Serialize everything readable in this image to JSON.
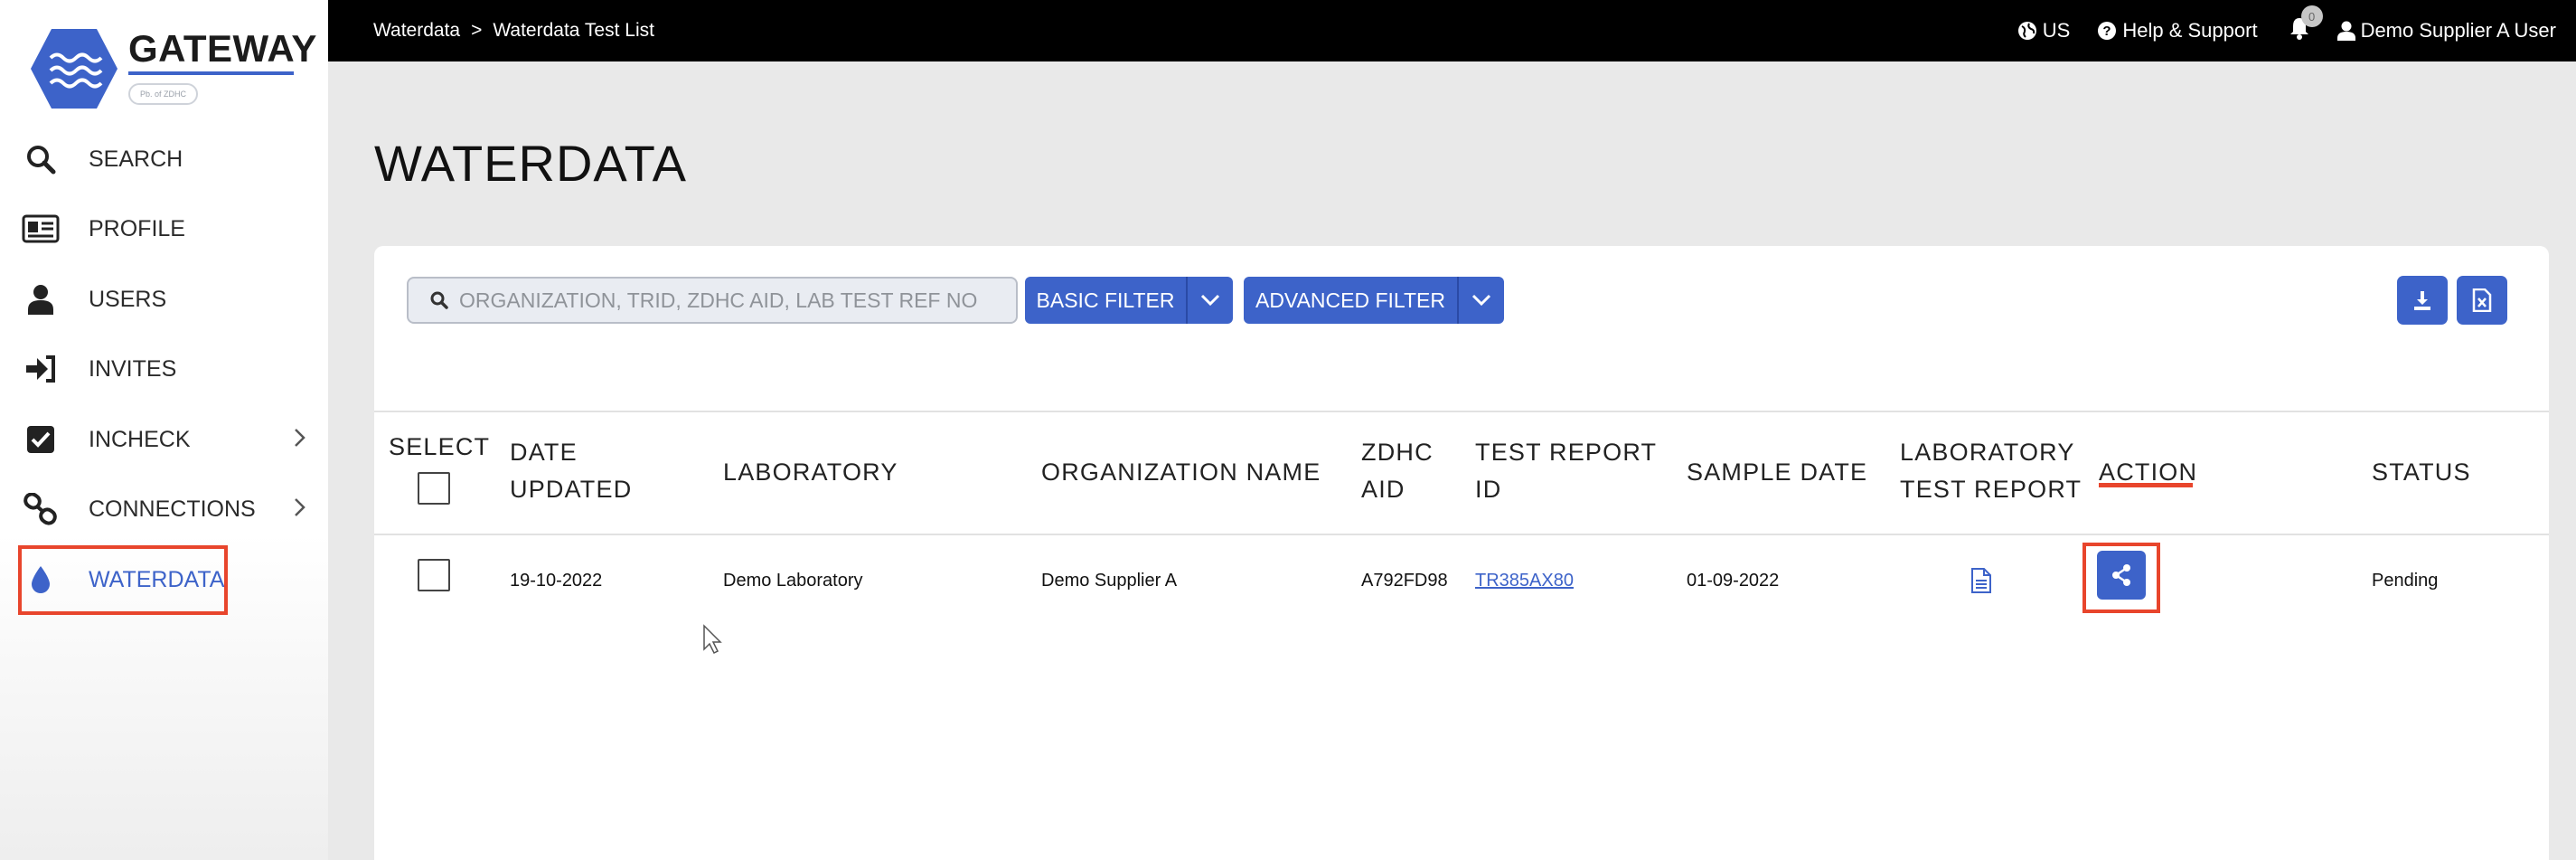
{
  "brand": {
    "name": "GATEWAY",
    "tagline": "Pb. of ZDHC",
    "accent": "#3d63c9",
    "highlight": "#e8452c"
  },
  "sidebar": {
    "items": [
      {
        "label": "SEARCH",
        "icon": "search-icon"
      },
      {
        "label": "PROFILE",
        "icon": "id-card-icon"
      },
      {
        "label": "USERS",
        "icon": "user-icon"
      },
      {
        "label": "INVITES",
        "icon": "sign-in-icon"
      },
      {
        "label": "INCHECK",
        "icon": "checkbox-icon",
        "expandable": true
      },
      {
        "label": "CONNECTIONS",
        "icon": "link-icon",
        "expandable": true
      },
      {
        "label": "WATERDATA",
        "icon": "water-drop-icon",
        "active": true
      }
    ]
  },
  "topbar": {
    "breadcrumb": [
      "Waterdata",
      "Waterdata Test List"
    ],
    "separator": ">",
    "region": "US",
    "help": "Help & Support",
    "notifications": "0",
    "user": "Demo Supplier A User"
  },
  "page": {
    "title": "WATERDATA"
  },
  "toolbar": {
    "search_placeholder": "ORGANIZATION, TRID, ZDHC AID, LAB TEST REF NO",
    "basic_filter": "BASIC FILTER",
    "advanced_filter": "ADVANCED FILTER",
    "download_icon": "download-icon",
    "excel_icon": "excel-icon"
  },
  "table": {
    "headers": {
      "select": "SELECT",
      "date_updated": [
        "DATE",
        "UPDATED"
      ],
      "laboratory": "LABORATORY",
      "organization": "ORGANIZATION NAME",
      "zdhc_aid": [
        "ZDHC",
        "AID"
      ],
      "test_report_id": [
        "TEST REPORT",
        "ID"
      ],
      "sample_date": "SAMPLE DATE",
      "lab_report": [
        "LABORATORY",
        "TEST REPORT"
      ],
      "action": "ACTION",
      "status": "STATUS"
    },
    "rows": [
      {
        "date_updated": "19-10-2022",
        "laboratory": "Demo Laboratory",
        "organization": "Demo Supplier A",
        "zdhc_aid": "A792FD98",
        "test_report_id": "TR385AX80",
        "sample_date": "01-09-2022",
        "lab_report_icon": "document-icon",
        "action_icon": "share-icon",
        "status": "Pending"
      }
    ]
  }
}
